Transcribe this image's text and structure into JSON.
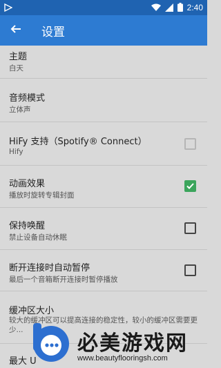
{
  "status_bar": {
    "time": "2:40",
    "icons": [
      "notification-play-icon",
      "wifi-icon",
      "signal-icon",
      "battery-icon"
    ]
  },
  "app_bar": {
    "title": "设置",
    "back_icon": "arrow-back-icon"
  },
  "settings": {
    "theme": {
      "title": "主题",
      "value": "白天"
    },
    "audio_mode": {
      "title": "音频模式",
      "value": "立体声"
    },
    "hifi": {
      "title": "HiFy 支持（Spotify® Connect）",
      "value": "Hify",
      "checked": false,
      "enabled": false
    },
    "animation": {
      "title": "动画效果",
      "value": "播放时旋转专辑封面",
      "checked": true,
      "enabled": true
    },
    "keep_awake": {
      "title": "保持唤醒",
      "value": "禁止设备自动休眠",
      "checked": false,
      "enabled": true
    },
    "auto_pause": {
      "title": "断开连接时自动暂停",
      "value": "最后一个音箱断开连接时暂停播放",
      "checked": false,
      "enabled": true
    },
    "buffer": {
      "title": "缓冲区大小",
      "value": "较大的缓冲区可以提高连接的稳定性，较小的缓冲区需要更少..."
    },
    "max": {
      "title": "最大 U"
    }
  },
  "watermark": {
    "title": "必美游戏网",
    "url": "www.beautyflooringsh.com"
  },
  "colors": {
    "status_bar": "#1f63b1",
    "app_bar": "#2d7bd2",
    "background": "#d9d9d9",
    "checkbox_checked": "#3ba55c"
  }
}
